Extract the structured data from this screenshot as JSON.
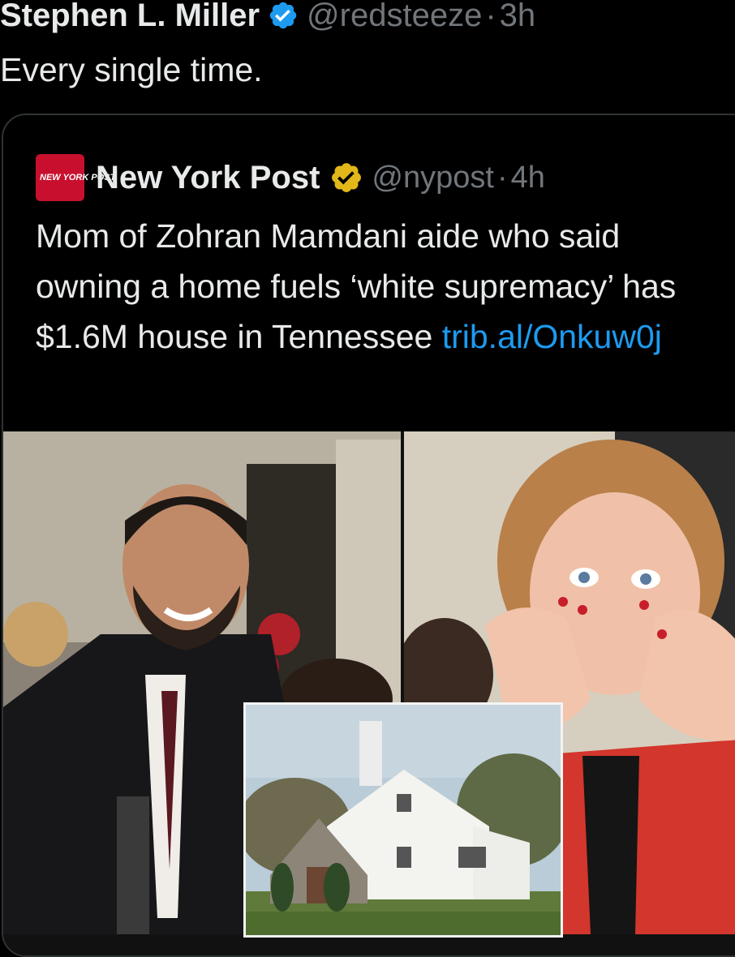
{
  "tweet": {
    "author_name": "Stephen L. Miller",
    "handle": "@redsteeze",
    "separator": "·",
    "time": "3h",
    "text": "Every single time.",
    "verified_badge": "blue-check-icon"
  },
  "quote": {
    "avatar_text": "NEW YORK POST",
    "author_name": "New York Post",
    "handle": "@nypost",
    "separator": "·",
    "time": "4h",
    "text": "Mom of Zohran Mamdani aide who said owning a home fuels ‘white supremacy’ has $1.6M house in Tennessee ",
    "link_text": "trib.al/​Onkuw0j",
    "verified_badge": "gold-check-icon"
  },
  "colors": {
    "background": "#000000",
    "text": "#e7e9ea",
    "muted": "#71767b",
    "link": "#1d9bf0",
    "verified_blue": "#1d9bf0",
    "verified_gold": "#e2b719",
    "nyp_red": "#c8102e"
  }
}
